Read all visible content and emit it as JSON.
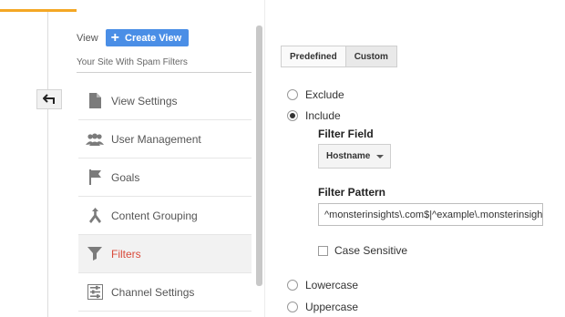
{
  "sidebar": {
    "view_label": "View",
    "create_view_label": "Create View",
    "site_name": "Your Site With Spam Filters",
    "items": [
      {
        "label": "View Settings",
        "icon": "document-icon"
      },
      {
        "label": "User Management",
        "icon": "users-icon"
      },
      {
        "label": "Goals",
        "icon": "flag-icon"
      },
      {
        "label": "Content Grouping",
        "icon": "content-grouping-icon"
      },
      {
        "label": "Filters",
        "icon": "funnel-icon",
        "active": true
      },
      {
        "label": "Channel Settings",
        "icon": "channel-settings-icon"
      }
    ]
  },
  "colors": {
    "accent": "#f4a724",
    "primary_button": "#4a8ee6",
    "active_nav_text": "#d94b3b"
  },
  "tabs": [
    {
      "label": "Predefined",
      "selected": false
    },
    {
      "label": "Custom",
      "selected": true
    }
  ],
  "filter": {
    "exclude_label": "Exclude",
    "include_label": "Include",
    "selected": "Include",
    "filter_field_heading": "Filter Field",
    "filter_field_value": "Hostname",
    "filter_pattern_heading": "Filter Pattern",
    "filter_pattern_value": "^monsterinsights\\.com$|^example\\.monsterinsights\\.com$",
    "case_sensitive_label": "Case Sensitive",
    "case_sensitive_checked": false,
    "lowercase_label": "Lowercase",
    "uppercase_label": "Uppercase"
  }
}
